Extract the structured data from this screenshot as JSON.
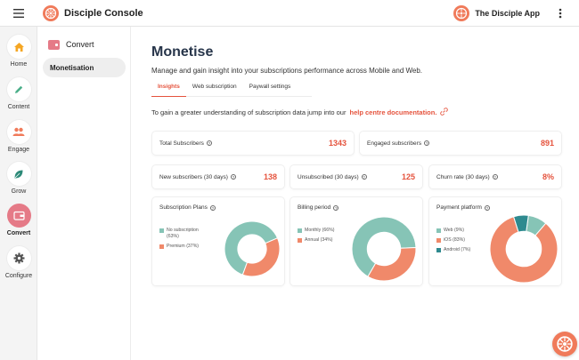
{
  "app": {
    "brand_name": "Disciple Console",
    "app_name": "The Disciple App",
    "brand_color": "#f07a5a",
    "accent_color": "#e5533d"
  },
  "rail": {
    "items": [
      {
        "label": "Home",
        "icon": "home-icon",
        "color": "#f5a623"
      },
      {
        "label": "Content",
        "icon": "pencil-icon",
        "color": "#4caf8a"
      },
      {
        "label": "Engage",
        "icon": "people-icon",
        "color": "#f07a5a"
      },
      {
        "label": "Grow",
        "icon": "leaf-icon",
        "color": "#2d8a78"
      },
      {
        "label": "Convert",
        "icon": "wallet-icon",
        "color": "#ffffff",
        "active": true
      },
      {
        "label": "Configure",
        "icon": "gear-icon",
        "color": "#555555"
      }
    ]
  },
  "subsidebar": {
    "header": "Convert",
    "items": [
      {
        "label": "Monetisation",
        "active": true
      }
    ]
  },
  "main": {
    "title": "Monetise",
    "description": "Manage and gain insight into your subscriptions performance across Mobile and Web.",
    "tabs": [
      {
        "label": "Insights",
        "active": true
      },
      {
        "label": "Web subscription",
        "active": false
      },
      {
        "label": "Paywall settings",
        "active": false
      }
    ],
    "info_text": "To gain a greater understanding of subscription data jump into our",
    "info_link": "help centre documentation."
  },
  "stats": [
    {
      "label": "Total Subscribers",
      "value": "1343"
    },
    {
      "label": "Engaged subscribers",
      "value": "891"
    },
    {
      "label": "New subscribers (30 days)",
      "value": "138"
    },
    {
      "label": "Unsubscribed (30 days)",
      "value": "125"
    },
    {
      "label": "Churn rate (30 days)",
      "value": "8%"
    }
  ],
  "chart_data": [
    {
      "type": "pie",
      "title": "Subscription Plans",
      "categories": [
        "No subscription (63%)",
        "Premium (37%)"
      ],
      "values": [
        63,
        37
      ],
      "colors": [
        "#86c4b6",
        "#f0896a"
      ]
    },
    {
      "type": "pie",
      "title": "Billing period",
      "categories": [
        "Monthly (66%)",
        "Annual (34%)"
      ],
      "values": [
        66,
        34
      ],
      "colors": [
        "#86c4b6",
        "#f0896a"
      ]
    },
    {
      "type": "pie",
      "title": "Payment platform",
      "categories": [
        "Web (9%)",
        "iOS (83%)",
        "Android (7%)"
      ],
      "values": [
        9,
        83,
        7
      ],
      "colors": [
        "#86c4b6",
        "#f0896a",
        "#2e8a8f"
      ]
    }
  ]
}
